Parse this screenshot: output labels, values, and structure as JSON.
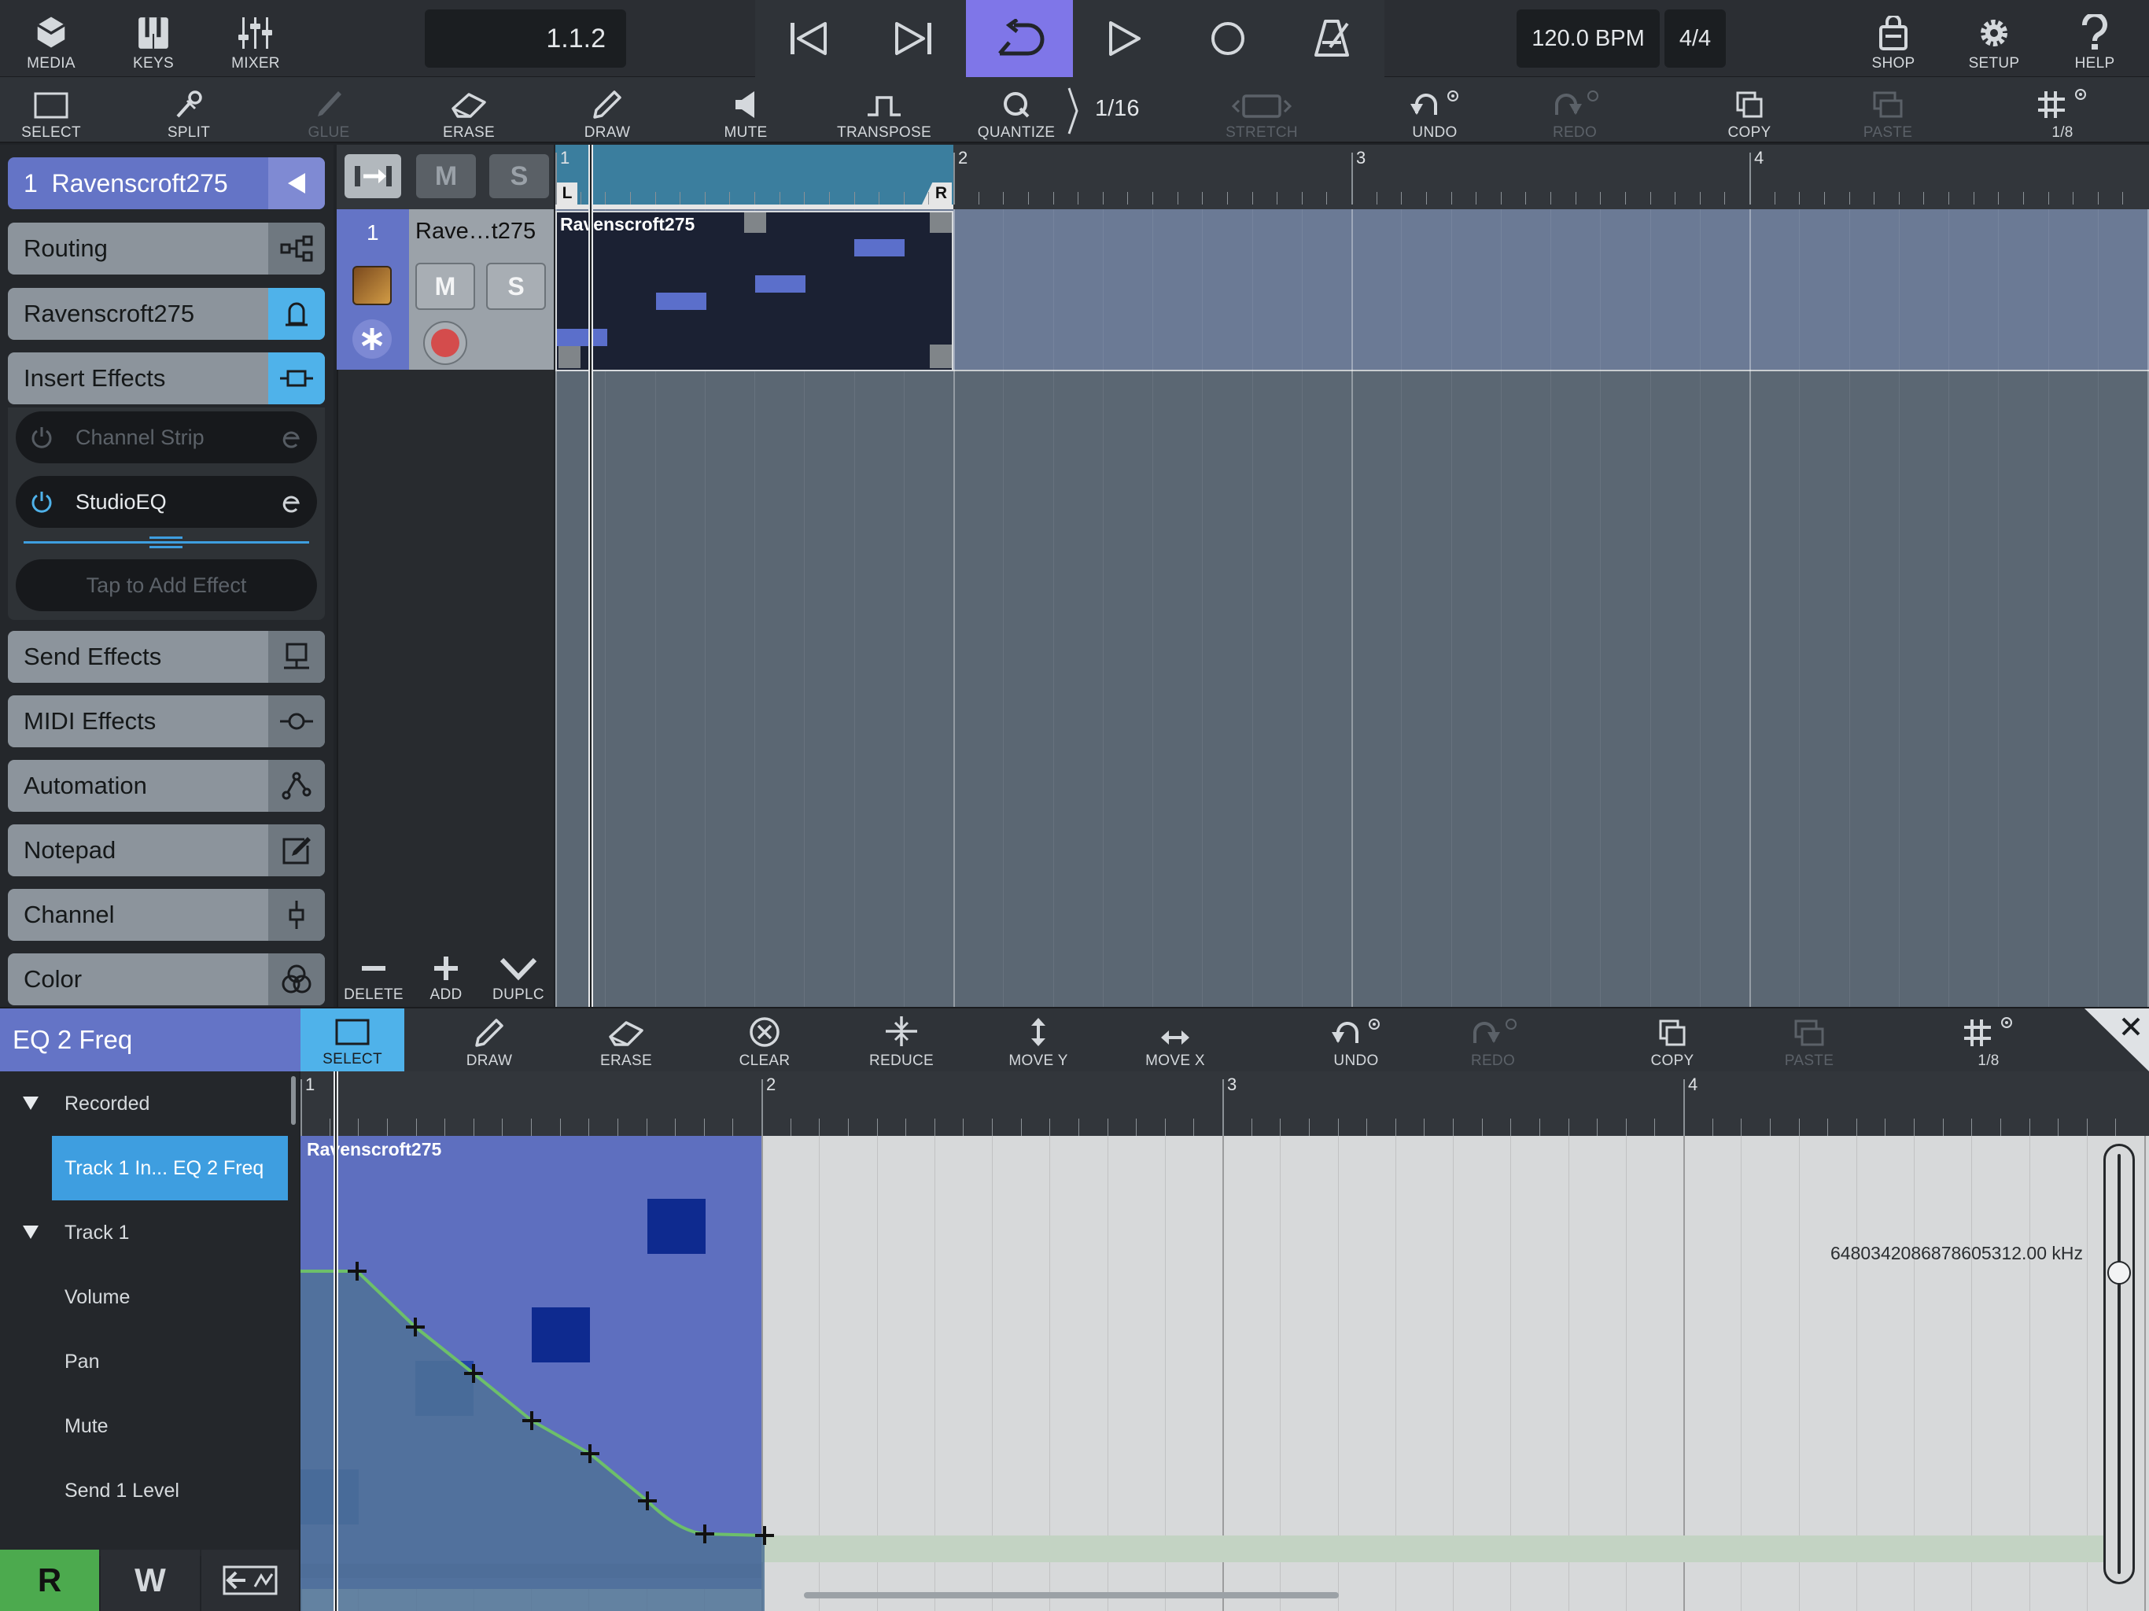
{
  "top_bar": {
    "media": "MEDIA",
    "keys": "KEYS",
    "mixer": "MIXER",
    "position": "1.1.2",
    "tempo": "120.0 BPM",
    "signature": "4/4",
    "shop": "SHOP",
    "setup": "SETUP",
    "help": "HELP"
  },
  "tool_bar": {
    "select": "SELECT",
    "split": "SPLIT",
    "glue": "GLUE",
    "erase": "ERASE",
    "draw": "DRAW",
    "mute": "MUTE",
    "transpose": "TRANSPOSE",
    "quantize": "QUANTIZE",
    "quantize_value": "1/16",
    "stretch": "STRETCH",
    "undo": "UNDO",
    "redo": "REDO",
    "copy": "COPY",
    "paste": "PASTE",
    "grid": "1/8"
  },
  "inspector": {
    "track_title": "1  Ravenscroft275",
    "routing": "Routing",
    "instrument": "Ravenscroft275",
    "insert_effects": "Insert Effects",
    "slot_channel_strip": "Channel Strip",
    "slot_studio_eq": "StudioEQ",
    "slot_add": "Tap to Add Effect",
    "send_effects": "Send Effects",
    "midi_effects": "MIDI Effects",
    "automation": "Automation",
    "notepad": "Notepad",
    "channel": "Channel",
    "color": "Color"
  },
  "track_list": {
    "header_m": "M",
    "header_s": "S",
    "track_number": "1",
    "track_name": "Rave…t275",
    "m": "M",
    "s": "S",
    "delete": "DELETE",
    "add": "ADD",
    "duplicate": "DUPLC"
  },
  "arrange": {
    "ruler": [
      "1",
      "2",
      "3",
      "4"
    ],
    "locator_left": "L",
    "locator_right": "R",
    "part_name": "Ravenscroft275"
  },
  "automation_editor": {
    "title": "EQ 2 Freq",
    "tools": {
      "select": "SELECT",
      "draw": "DRAW",
      "erase": "ERASE",
      "clear": "CLEAR",
      "reduce": "REDUCE",
      "move_y": "MOVE Y",
      "move_x": "MOVE X",
      "undo": "UNDO",
      "redo": "REDO",
      "copy": "COPY",
      "paste": "PASTE",
      "grid": "1/8"
    },
    "ruler": [
      "1",
      "2",
      "3",
      "4"
    ],
    "part_name": "Ravenscroft275",
    "value_readout": "6480342086878605312.00 kHz",
    "list": {
      "group_recorded": "Recorded",
      "selected_item": "Track 1 In... EQ 2 Freq",
      "group_track": "Track 1",
      "volume": "Volume",
      "pan": "Pan",
      "mute": "Mute",
      "send1": "Send 1 Level"
    },
    "read": "R",
    "write": "W"
  },
  "colors": {
    "accent_purple": "#7f76e8",
    "accent_blue": "#3e9ee0",
    "track_blue": "#6474c6",
    "read_green": "#4caa4e",
    "automation_line": "#6dbf6a"
  }
}
